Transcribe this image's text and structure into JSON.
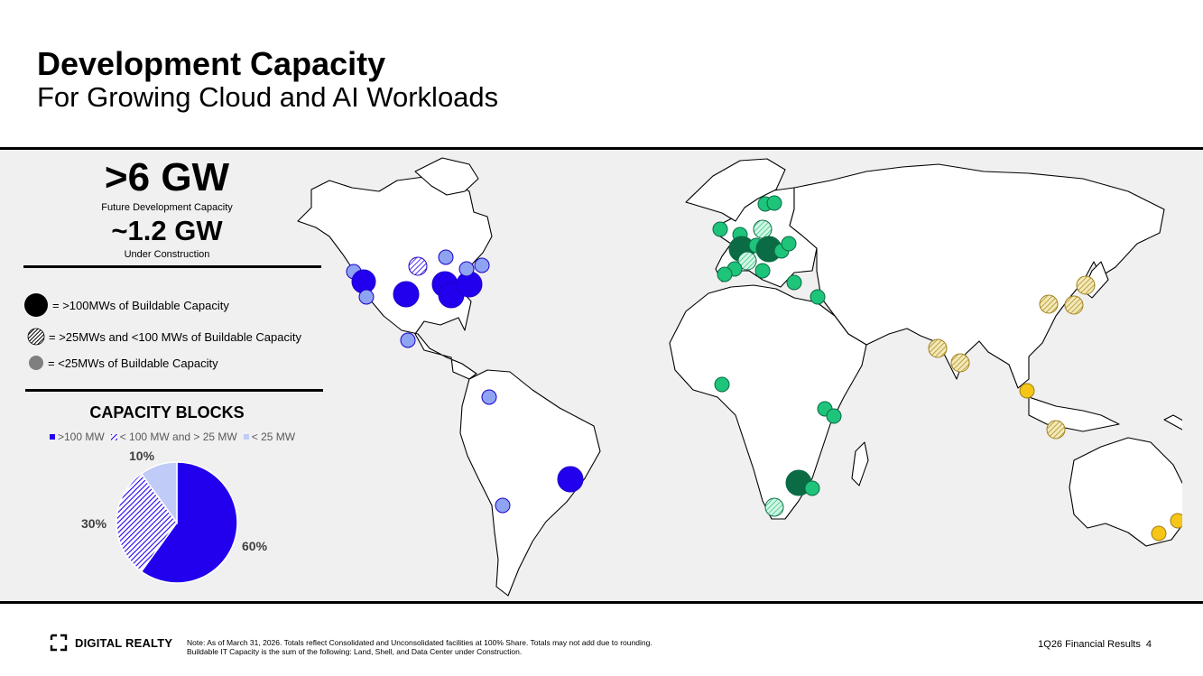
{
  "header": {
    "title": "Development Capacity",
    "subtitle": "For Growing Cloud and AI Workloads"
  },
  "stats": {
    "future_value": ">6 GW",
    "future_label": "Future Development Capacity",
    "construction_value": "~1.2 GW",
    "construction_label": "Under Construction"
  },
  "size_legend": {
    "large": "= >100MWs of Buildable Capacity",
    "medium": "= >25MWs and <100 MWs of Buildable Capacity",
    "small": "= <25MWs of Buildable Capacity"
  },
  "chart_data": {
    "type": "pie",
    "title": "CAPACITY BLOCKS",
    "categories": [
      ">100 MW",
      "< 100 MW and > 25 MW",
      "< 25 MW"
    ],
    "values": [
      60,
      30,
      10
    ],
    "labels": [
      "60%",
      "30%",
      "10%"
    ],
    "colors": [
      "#2200ee",
      "#2200ee",
      "#c0cbf7"
    ],
    "legend_position": "top"
  },
  "map": {
    "region_colors": {
      "americas": "#2200ee",
      "americas_light": "#8ea3f2",
      "emea": "#1ec47a",
      "emea_dark": "#0a6b45",
      "apac_hatched": "#c6a93a",
      "apac": "#f5c518"
    }
  },
  "footer": {
    "brand": "DIGITAL REALTY",
    "note_line1": "Note: As of March 31, 2026. Totals reflect Consolidated and Unconsolidated facilities at 100% Share. Totals may not add due to rounding.",
    "note_line2": "Buildable IT Capacity is the sum of the following: Land, Shell, and Data Center under Construction.",
    "report": "1Q26 Financial Results",
    "page": "4"
  }
}
